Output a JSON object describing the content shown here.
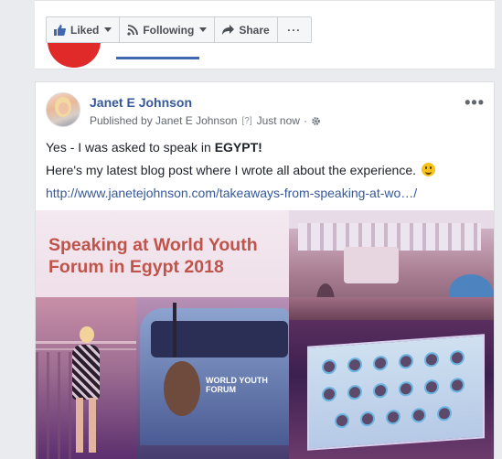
{
  "page_actions": {
    "liked_label": "Liked",
    "following_label": "Following",
    "share_label": "Share",
    "more_label": "···"
  },
  "post": {
    "author": "Janet E Johnson",
    "published_by": "Published by Janet E Johnson",
    "help_marker": "[?]",
    "separator": "·",
    "timestamp": "Just now",
    "options_label": "•••",
    "line1_prefix": "Yes - I was asked to speak in ",
    "line1_bold": "EGYPT!",
    "line2": "Here's my latest blog post where I wrote all about the experience.",
    "link": "http://www.janetejohnson.com/takeaways-from-speaking-at-wo…/",
    "image_title": "Speaking at World Youth Forum in Egypt 2018",
    "bus_sign": "WORLD YOUTH FORUM"
  },
  "colors": {
    "link_blue": "#365899",
    "brand_blue": "#4267b2",
    "title_red": "#c0534a"
  }
}
